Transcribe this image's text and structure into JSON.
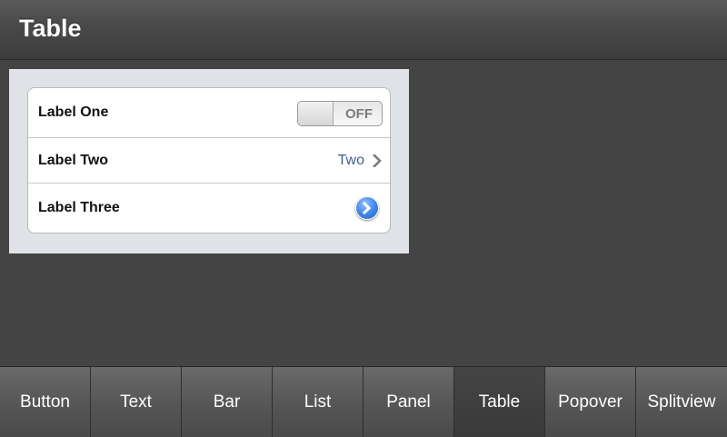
{
  "header": {
    "title": "Table"
  },
  "table": {
    "rows": [
      {
        "label": "Label One",
        "control": "toggle",
        "toggle_state": "OFF"
      },
      {
        "label": "Label Two",
        "control": "detail",
        "value": "Two"
      },
      {
        "label": "Label Three",
        "control": "disclosure-button"
      }
    ]
  },
  "tabs": [
    {
      "label": "Button",
      "active": false
    },
    {
      "label": "Text",
      "active": false
    },
    {
      "label": "Bar",
      "active": false
    },
    {
      "label": "List",
      "active": false
    },
    {
      "label": "Panel",
      "active": false
    },
    {
      "label": "Table",
      "active": true
    },
    {
      "label": "Popover",
      "active": false
    },
    {
      "label": "Splitview",
      "active": false
    }
  ],
  "icons": {
    "chevron": "chevron-right-icon",
    "disclosure": "detail-disclosure-icon"
  },
  "colors": {
    "background": "#444444",
    "panel": "#dfe2e6",
    "detail_text": "#3f5f8f",
    "disclosure_blue": "#3f83e6"
  }
}
